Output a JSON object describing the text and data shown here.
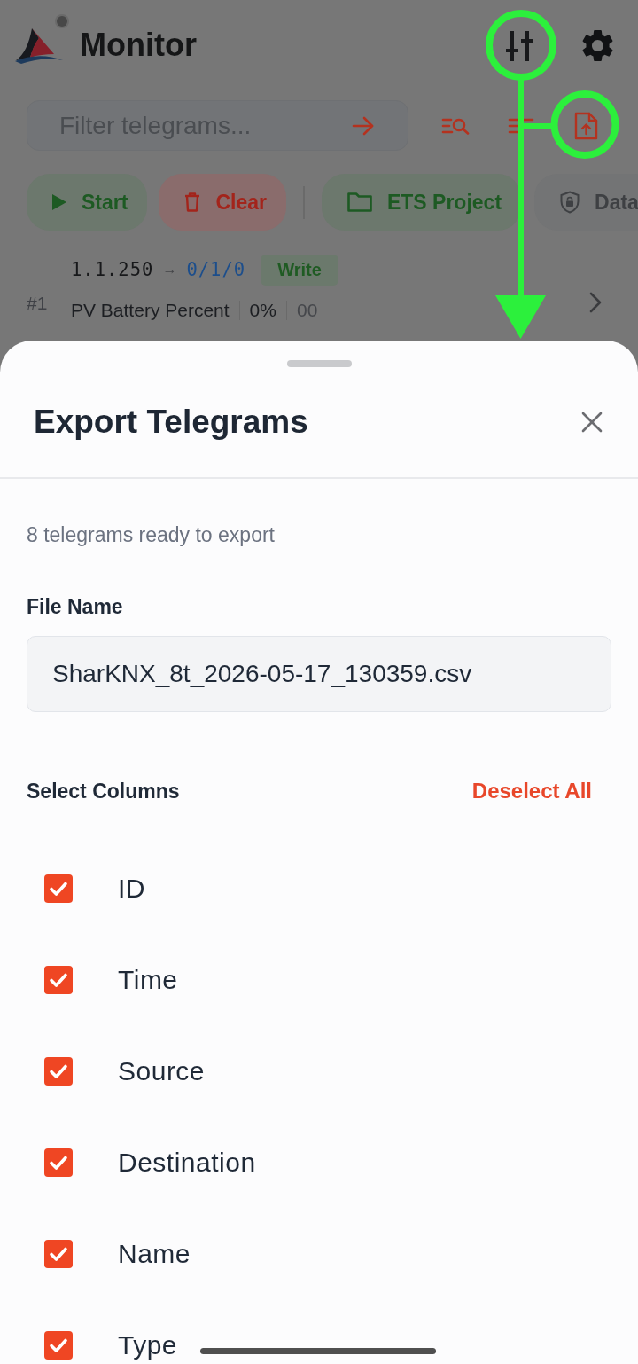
{
  "app": {
    "title": "Monitor"
  },
  "filter": {
    "placeholder": "Filter telegrams..."
  },
  "actions": [
    {
      "kind": "start",
      "label": "Start"
    },
    {
      "kind": "clear",
      "label": "Clear"
    },
    {
      "kind": "project",
      "label": "ETS Project"
    },
    {
      "kind": "data",
      "label": "Data"
    }
  ],
  "telegrams": [
    {
      "index": "#1",
      "source": "1.1.250",
      "arrow": "→",
      "destination": "0/1/0",
      "service": "Write",
      "name": "PV Battery Percent",
      "value": "0%",
      "raw": "00"
    }
  ],
  "export_sheet": {
    "title": "Export Telegrams",
    "summary": "8 telegrams ready to export",
    "file_name_label": "File Name",
    "file_name": "SharKNX_8t_2026-05-17_130359.csv",
    "columns_label": "Select Columns",
    "deselect_all": "Deselect All",
    "columns": [
      {
        "label": "ID",
        "checked": true
      },
      {
        "label": "Time",
        "checked": true
      },
      {
        "label": "Source",
        "checked": true
      },
      {
        "label": "Destination",
        "checked": true
      },
      {
        "label": "Name",
        "checked": true
      },
      {
        "label": "Type",
        "checked": true
      }
    ]
  }
}
